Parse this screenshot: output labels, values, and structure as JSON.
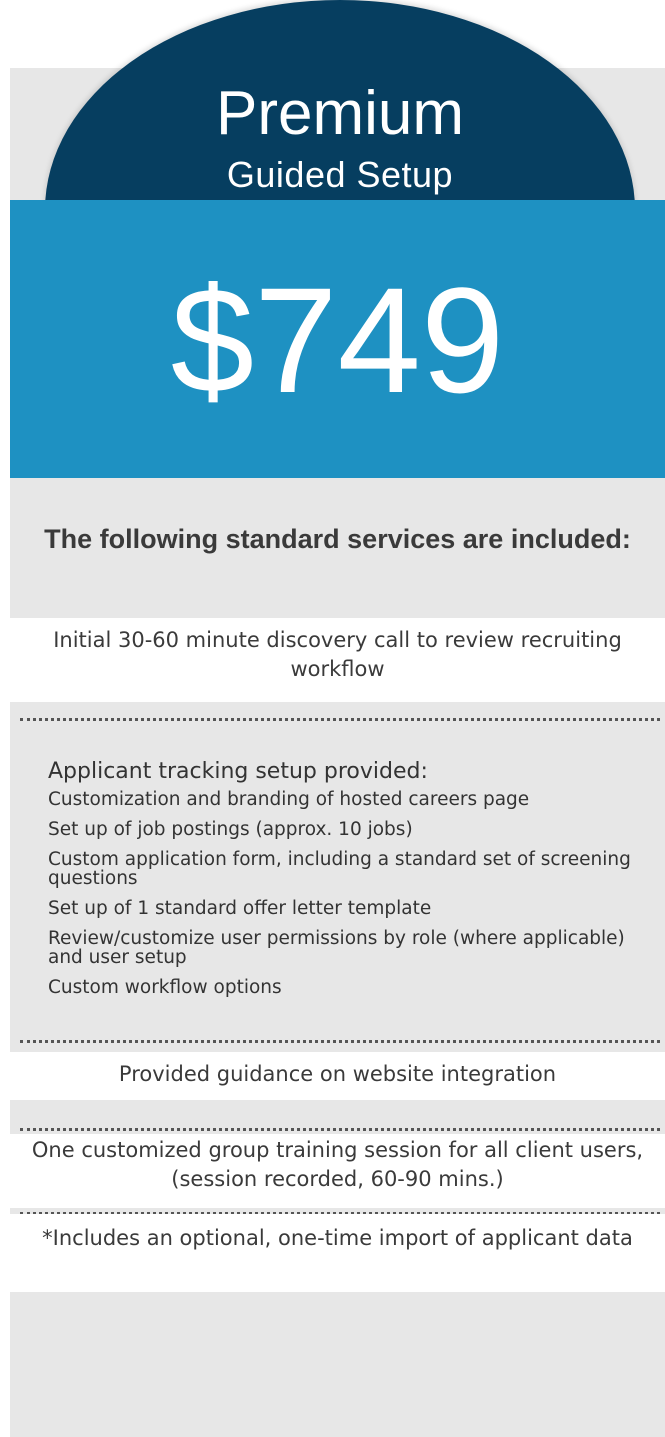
{
  "header": {
    "title": "Premium",
    "subtitle": "Guided Setup"
  },
  "price": "$749",
  "heading": "The following standard services are included:",
  "services": {
    "discovery": "Initial 30-60 minute discovery call to review recruiting workflow",
    "ats_title": "Applicant tracking setup provided:",
    "ats_items": [
      "Customization and branding of hosted careers page",
      "Set up of job postings (approx. 10 jobs)",
      "Custom application form, including a standard set of screening questions",
      "Set up of 1 standard offer letter template",
      "Review/customize user permissions by role (where applicable) and user setup",
      "Custom workflow options"
    ],
    "website": "Provided guidance on website integration",
    "training": "One customized group training session for all client users, (session recorded, 60-90 mins.)",
    "import": "*Includes an optional, one-time import of applicant data"
  },
  "colors": {
    "dome": "#063e60",
    "price_band": "#1e91c2",
    "card": "#e7e7e7"
  }
}
